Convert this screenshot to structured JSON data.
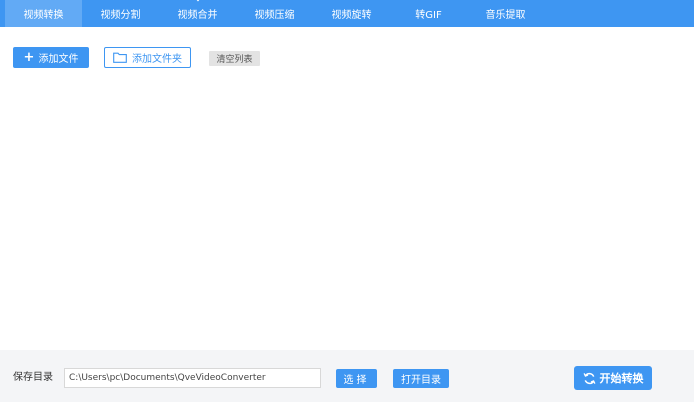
{
  "nav": {
    "tabs": [
      {
        "label": "视频转换",
        "icon": "convert-icon",
        "active": true
      },
      {
        "label": "视频分割",
        "icon": "split-icon",
        "active": false
      },
      {
        "label": "视频合并",
        "icon": "merge-icon",
        "active": false
      },
      {
        "label": "视频压缩",
        "icon": "compress-icon",
        "active": false
      },
      {
        "label": "视频旋转",
        "icon": "rotate-icon",
        "active": false
      },
      {
        "label": "转GIF",
        "icon": "gif-icon",
        "active": false
      },
      {
        "label": "音乐提取",
        "icon": "music-icon",
        "active": false
      }
    ]
  },
  "toolbar": {
    "add_file_label": "添加文件",
    "add_folder_label": "添加文件夹",
    "clear_list_label": "清空列表"
  },
  "bottom": {
    "save_dir_label": "保存目录",
    "save_path": "C:\\Users\\pc\\Documents\\QveVideoConverter",
    "choose_label": "选择",
    "open_dir_label": "打开目录",
    "start_label": "开始转换"
  },
  "colors": {
    "accent": "#3e96f2",
    "active_tab": "#62aaf5",
    "bottom_bar": "#f4f5f7"
  }
}
